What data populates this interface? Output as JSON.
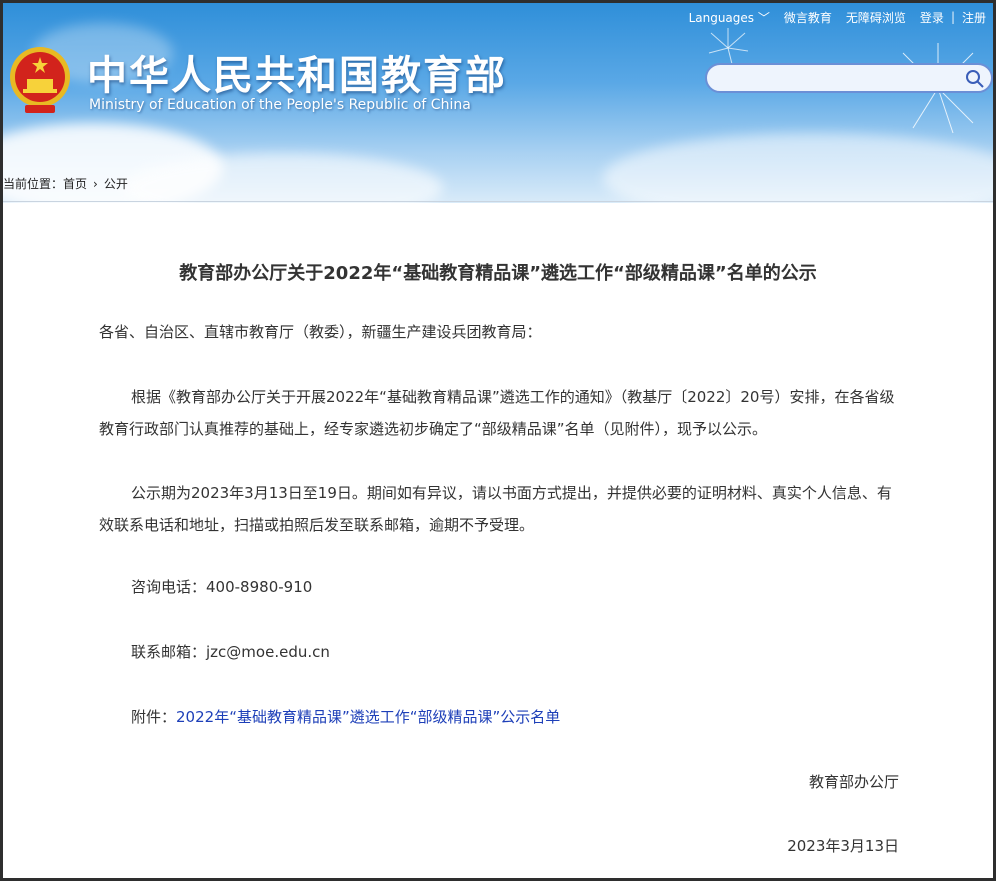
{
  "header": {
    "top_links": [
      "Languages",
      "微言教育",
      "无障碍浏览",
      "登录",
      "注册"
    ],
    "title_cn": "中华人民共和国教育部",
    "title_en": "Ministry of Education of the People's Republic of China",
    "search_placeholder": ""
  },
  "breadcrumb": {
    "label": "当前位置：",
    "items": [
      "首页",
      "公开"
    ]
  },
  "article": {
    "title": "教育部办公厅关于2022年“基础教育精品课”遴选工作“部级精品课”名单的公示",
    "salutation": "各省、自治区、直辖市教育厅（教委），新疆生产建设兵团教育局：",
    "para1": "根据《教育部办公厅关于开展2022年“基础教育精品课”遴选工作的通知》（教基厅〔2022〕20号）安排，在各省级教育行政部门认真推荐的基础上，经专家遴选初步确定了“部级精品课”名单（见附件），现予以公示。",
    "para2": "公示期为2023年3月13日至19日。期间如有异议，请以书面方式提出，并提供必要的证明材料、真实个人信息、有效联系电话和地址，扫描或拍照后发至联系邮箱，逾期不予受理。",
    "phone_label": "咨询电话：",
    "phone": "400-8980-910",
    "email_label": "联系邮箱：",
    "email": "jzc@moe.edu.cn",
    "attachment_label": "附件：",
    "attachment_link": "2022年“基础教育精品课”遴选工作“部级精品课”公示名单",
    "signature": "教育部办公厅",
    "date": "2023年3月13日"
  },
  "colors": {
    "header_blue": "#2f8fd9",
    "link": "#1d3fb8",
    "border": "#2e2e2e"
  }
}
